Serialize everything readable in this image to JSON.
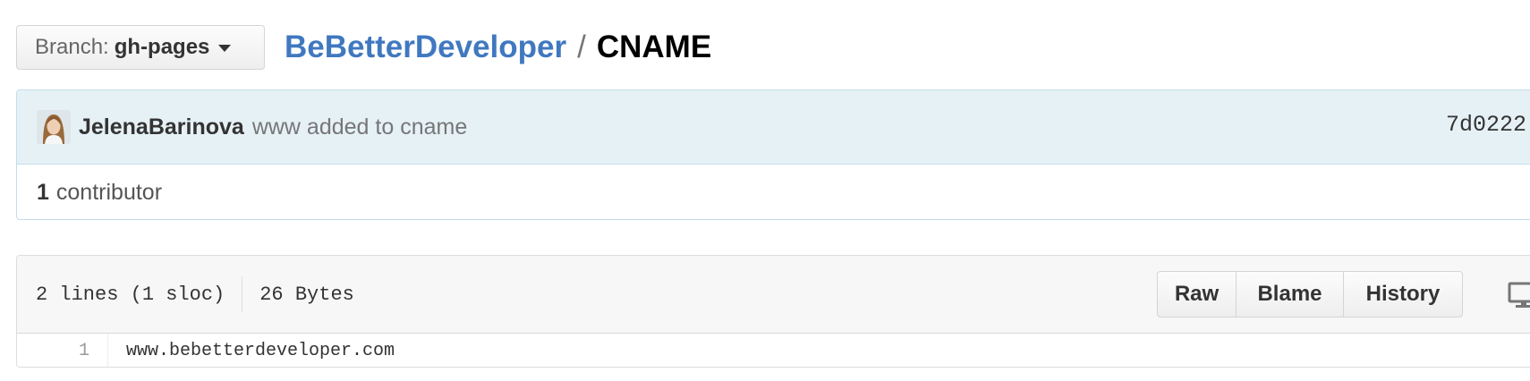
{
  "branch": {
    "prefix": "Branch:",
    "value": "gh-pages",
    "icon": "caret-down-icon"
  },
  "breadcrumb": {
    "repo": "BeBetterDeveloper",
    "separator": "/",
    "file": "CNAME"
  },
  "commit": {
    "author": "JelenaBarinova",
    "message": "www added to cname",
    "sha": "7d0222"
  },
  "contributors": {
    "count": "1",
    "label": "contributor"
  },
  "file": {
    "lines": "2 lines (1 sloc)",
    "size": "26 Bytes",
    "actions": {
      "raw": "Raw",
      "blame": "Blame",
      "history": "History"
    },
    "desktop_icon": "desktop-icon",
    "code": [
      {
        "num": "1",
        "text": "www.bebetterdeveloper.com"
      }
    ]
  },
  "colors": {
    "link": "#4078c0",
    "commit_bg": "#e6f1f6",
    "commit_border": "#c5dcec"
  }
}
